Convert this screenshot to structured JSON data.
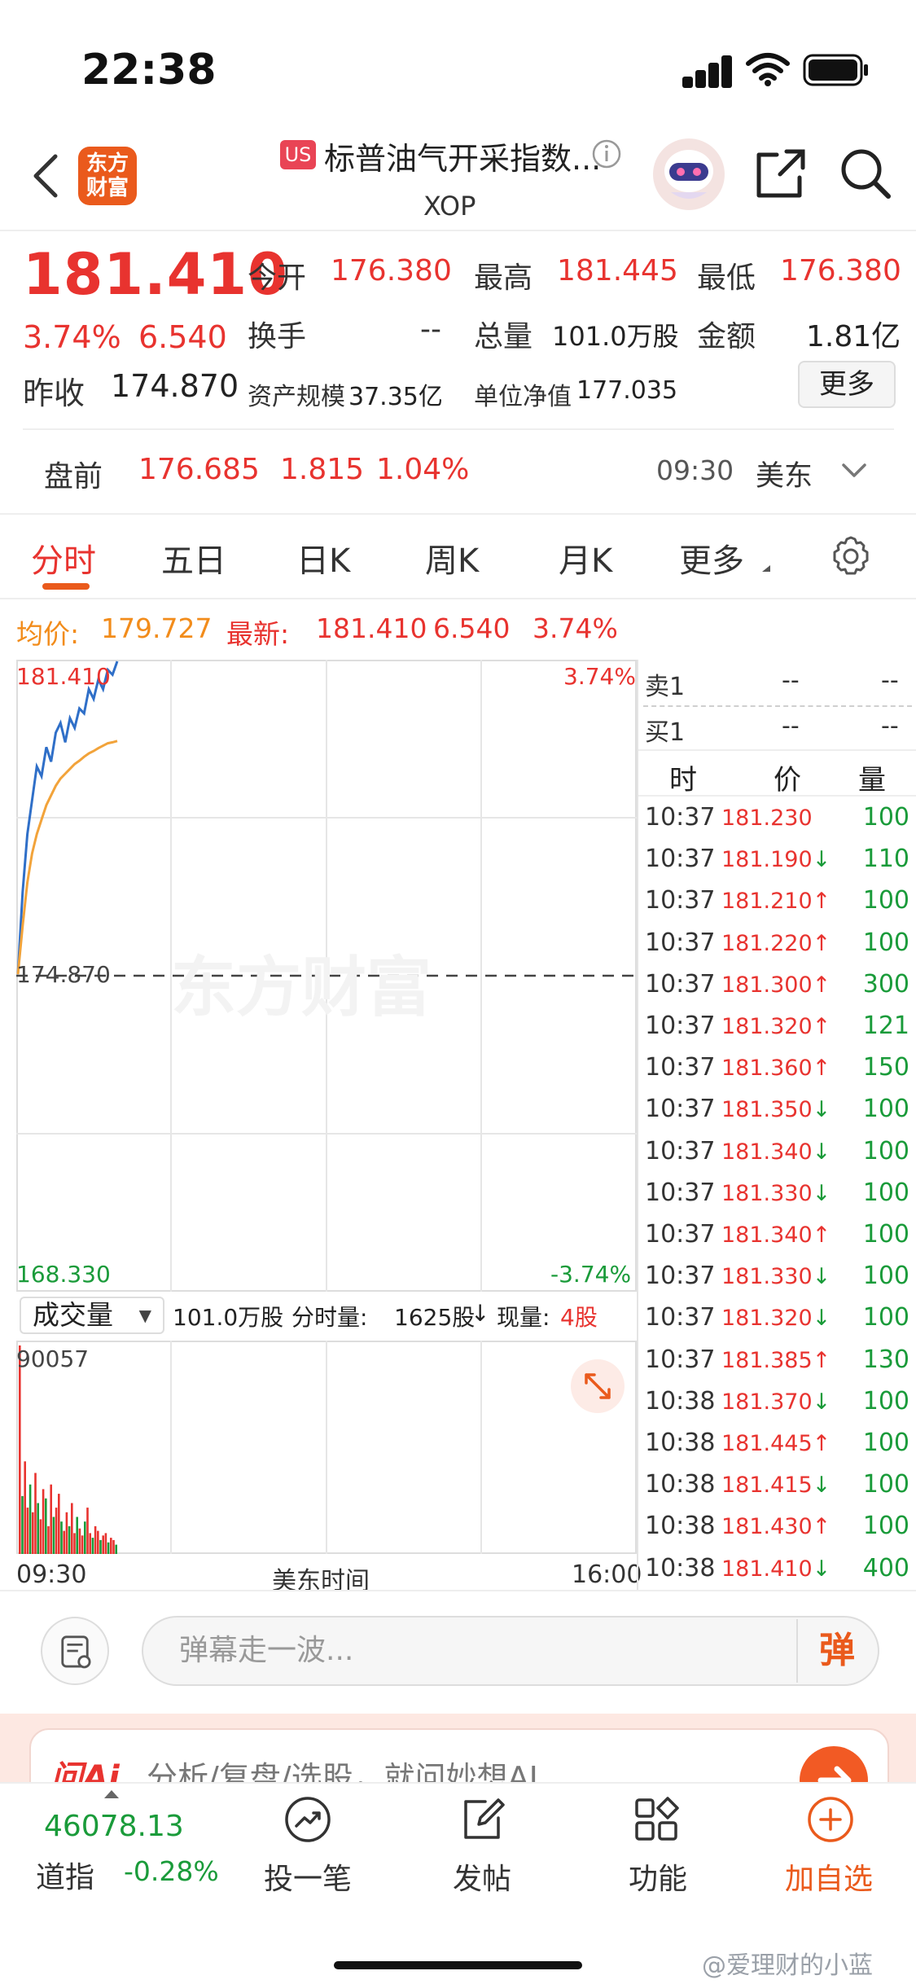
{
  "status": {
    "time": "22:38"
  },
  "header": {
    "logo_text_1": "东方",
    "logo_text_2": "财富",
    "market_badge": "US",
    "stock_name": "标普油气开采指数...",
    "stock_code": "XOP"
  },
  "quote": {
    "price": "181.410",
    "change_pct": "3.74%",
    "change": "6.540",
    "prev_close_label": "昨收",
    "prev_close": "174.870",
    "open_label": "今开",
    "open": "176.380",
    "high_label": "最高",
    "high": "181.445",
    "low_label": "最低",
    "low": "176.380",
    "turnover_label": "换手",
    "turnover": "--",
    "volume_label": "总量",
    "volume": "101.0万股",
    "amount_label": "金额",
    "amount": "1.81亿",
    "asset_label": "资产规模",
    "asset": "37.35亿",
    "nav_label": "单位净值",
    "nav": "177.035",
    "more_label": "更多"
  },
  "premarket": {
    "label": "盘前",
    "price": "176.685",
    "change": "1.815",
    "change_pct": "1.04%",
    "time": "09:30",
    "zone": "美东"
  },
  "tabs": [
    "分时",
    "五日",
    "日K",
    "周K",
    "月K",
    "更多"
  ],
  "avg_line": {
    "avg_label": "均价:",
    "avg_value": "179.727",
    "latest_label": "最新:",
    "latest_price": "181.410",
    "latest_change": "6.540",
    "latest_pct": "3.74%"
  },
  "chart_data": {
    "type": "line",
    "title": "",
    "xlabel": "美东时间",
    "x_ticks": [
      "09:30",
      "16:00"
    ],
    "y_top": "181.410",
    "y_mid": "174.870",
    "y_bottom": "168.330",
    "pct_top": "3.74%",
    "pct_bottom": "-3.74%",
    "ylim": [
      168.33,
      181.41
    ],
    "series": [
      {
        "color": "#2f6fc8",
        "values": [
          174.9,
          176.6,
          177.8,
          178.5,
          179.2,
          179.0,
          179.6,
          179.3,
          179.9,
          180.1,
          179.7,
          180.2,
          180.0,
          180.4,
          180.3,
          180.8,
          180.6,
          181.0,
          180.8,
          181.2,
          181.1,
          181.41
        ]
      },
      {
        "color": "#f2a33a",
        "values": [
          174.9,
          175.9,
          176.8,
          177.4,
          177.8,
          178.1,
          178.4,
          178.6,
          178.8,
          178.95,
          179.05,
          179.15,
          179.25,
          179.32,
          179.4,
          179.47,
          179.52,
          179.58,
          179.63,
          179.68,
          179.7,
          179.727
        ]
      }
    ]
  },
  "volume_bar": {
    "selector_label": "成交量",
    "total": "101.0万股",
    "minute_label": "分时量:",
    "minute_value": "1625股",
    "arrow": "↓",
    "current_label": "现量:",
    "current_value": "4股",
    "max_value": "90057"
  },
  "volume_data": {
    "type": "bar",
    "ylim": [
      0,
      90057
    ],
    "values": [
      90057,
      25000,
      40000,
      20000,
      30000,
      18000,
      35000,
      22000,
      15000,
      28000,
      24000,
      12000,
      30000,
      16000,
      20000,
      26000,
      14000,
      10000,
      18000,
      12000,
      22000,
      9000,
      16000,
      11000,
      8000,
      14000,
      20000,
      9000,
      7000,
      12000,
      10000,
      6000,
      8000,
      9000,
      5000,
      7000,
      6000,
      4000
    ]
  },
  "order_book": {
    "sell1_label": "卖1",
    "sell1_price": "--",
    "sell1_vol": "--",
    "buy1_label": "买1",
    "buy1_price": "--",
    "buy1_vol": "--",
    "col_time": "时",
    "col_price": "价",
    "col_vol": "量",
    "trades": [
      {
        "time": "10:37",
        "price": "181.230",
        "dir": "",
        "vol": "100"
      },
      {
        "time": "10:37",
        "price": "181.190",
        "dir": "↓",
        "vol": "110"
      },
      {
        "time": "10:37",
        "price": "181.210",
        "dir": "↑",
        "vol": "100"
      },
      {
        "time": "10:37",
        "price": "181.220",
        "dir": "↑",
        "vol": "100"
      },
      {
        "time": "10:37",
        "price": "181.300",
        "dir": "↑",
        "vol": "300"
      },
      {
        "time": "10:37",
        "price": "181.320",
        "dir": "↑",
        "vol": "121"
      },
      {
        "time": "10:37",
        "price": "181.360",
        "dir": "↑",
        "vol": "150"
      },
      {
        "time": "10:37",
        "price": "181.350",
        "dir": "↓",
        "vol": "100"
      },
      {
        "time": "10:37",
        "price": "181.340",
        "dir": "↓",
        "vol": "100"
      },
      {
        "time": "10:37",
        "price": "181.330",
        "dir": "↓",
        "vol": "100"
      },
      {
        "time": "10:37",
        "price": "181.340",
        "dir": "↑",
        "vol": "100"
      },
      {
        "time": "10:37",
        "price": "181.330",
        "dir": "↓",
        "vol": "100"
      },
      {
        "time": "10:37",
        "price": "181.320",
        "dir": "↓",
        "vol": "100"
      },
      {
        "time": "10:37",
        "price": "181.385",
        "dir": "↑",
        "vol": "130"
      },
      {
        "time": "10:38",
        "price": "181.370",
        "dir": "↓",
        "vol": "100"
      },
      {
        "time": "10:38",
        "price": "181.445",
        "dir": "↑",
        "vol": "100"
      },
      {
        "time": "10:38",
        "price": "181.415",
        "dir": "↓",
        "vol": "100"
      },
      {
        "time": "10:38",
        "price": "181.430",
        "dir": "↑",
        "vol": "100"
      },
      {
        "time": "10:38",
        "price": "181.410",
        "dir": "↓",
        "vol": "400"
      }
    ]
  },
  "comment": {
    "placeholder": "弹幕走一波...",
    "send_label": "弹"
  },
  "ai_bar": {
    "logo": "问Ai",
    "text": "分析/复盘/选股，就问妙想AI"
  },
  "bottom_nav": {
    "index_value": "46078.13",
    "index_name": "道指",
    "index_change": "-0.28%",
    "items": [
      "投一笔",
      "发帖",
      "功能",
      "加自选"
    ]
  },
  "watermark": {
    "chart": "东方财富",
    "weibo": "@爱理财的小蓝"
  },
  "colors": {
    "up": "#e8332f",
    "down": "#1a9b3a",
    "accent": "#ea5a1c",
    "avg": "#f2a33a",
    "price_line": "#2f6fc8"
  }
}
